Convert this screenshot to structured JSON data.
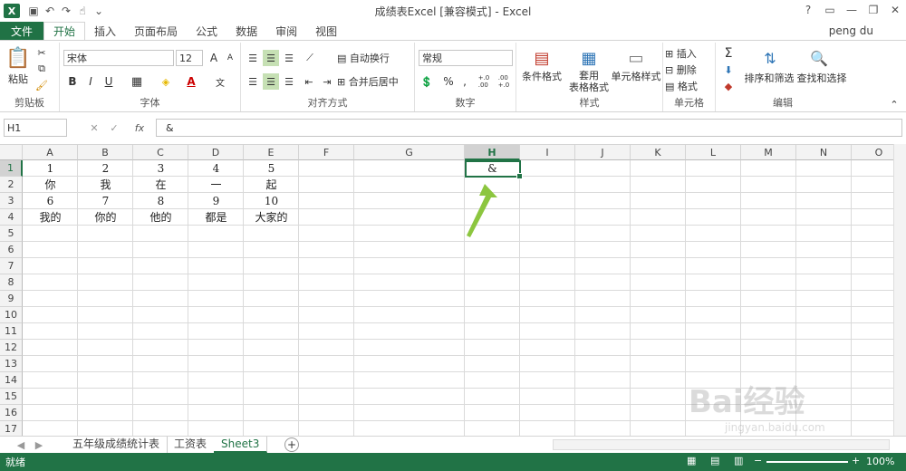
{
  "titlebar": {
    "title": "成绩表Excel  [兼容模式] - Excel",
    "user": "peng du",
    "help": "?"
  },
  "ribbon_tabs": [
    "文件",
    "开始",
    "插入",
    "页面布局",
    "公式",
    "数据",
    "审阅",
    "视图"
  ],
  "ribbon": {
    "clipboard": {
      "paste": "粘贴",
      "label": "剪贴板"
    },
    "font": {
      "name": "宋体",
      "size": "12",
      "label": "字体",
      "bold": "B",
      "italic": "I",
      "underline": "U",
      "grow": "A",
      "shrink": "A",
      "font_color": "A",
      "wen": "文"
    },
    "align": {
      "wrap": "自动换行",
      "merge": "合并后居中",
      "label": "对齐方式"
    },
    "number": {
      "format": "常规",
      "label": "数字",
      "percent": "%",
      "comma": ",",
      "inc": "+.0\n.00",
      "dec": ".00\n+.0"
    },
    "styles": {
      "cond": "条件格式",
      "table": "套用\n表格格式",
      "cell": "单元格样式",
      "label": "样式"
    },
    "cells": {
      "insert": "插入",
      "delete": "删除",
      "format": "格式",
      "label": "单元格"
    },
    "edit": {
      "sum": "Σ",
      "sort": "排序和筛选",
      "find": "查找和选择",
      "label": "编辑"
    }
  },
  "formula_bar": {
    "name_box": "H1",
    "content": "&",
    "fx": "fx"
  },
  "columns": [
    "A",
    "B",
    "C",
    "D",
    "E",
    "F",
    "G",
    "H",
    "I",
    "J",
    "K",
    "L",
    "M",
    "N",
    "O"
  ],
  "rows": [
    "1",
    "2",
    "3",
    "4",
    "5",
    "6",
    "7",
    "8",
    "9",
    "10",
    "11",
    "12",
    "13",
    "14",
    "15",
    "16",
    "17"
  ],
  "cells": [
    [
      "1",
      "2",
      "3",
      "4",
      "5"
    ],
    [
      "你",
      "我",
      "在",
      "一",
      "起"
    ],
    [
      "6",
      "7",
      "8",
      "9",
      "10"
    ],
    [
      "我的",
      "你的",
      "他的",
      "都是",
      "大家的"
    ]
  ],
  "selected_cell": {
    "ref": "H1",
    "value": "&"
  },
  "sheets": [
    "五年级成绩统计表",
    "工资表",
    "Sheet3"
  ],
  "active_sheet": "Sheet3",
  "status": {
    "ready": "就绪",
    "zoom": "100%"
  },
  "watermark": {
    "brand": "Bai经验",
    "url": "jingyan.baidu.com"
  },
  "colors": {
    "accent": "#217346",
    "arrow": "#8cc63f"
  }
}
